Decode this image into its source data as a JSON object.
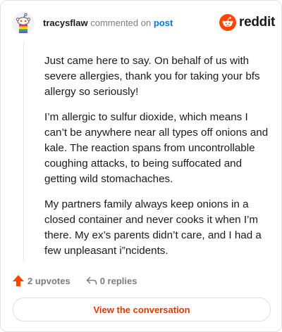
{
  "header": {
    "username": "tracysflaw",
    "commented_on": "commented on",
    "post_link": "post"
  },
  "brand": {
    "wordmark": "reddit",
    "logo_icon": "reddit-alien-icon",
    "color": "#ff4500"
  },
  "comment": {
    "paragraphs": [
      "Just came here to say. On behalf of us with severe allergies, thank you for taking your bfs allergy so seriously!",
      "I’m allergic to sulfur dioxide, which means I can’t be anywhere near all types off onions and kale. The reaction spans from uncontrollable coughing attacks, to being suffocated and getting wild stomachaches.",
      "My partners family always keep onions in a closed container and never cooks it when I’m there. My ex’s parents didn’t care, and I had a few unpleasant i”ncidents."
    ]
  },
  "actions": {
    "upvotes": "2 upvotes",
    "upvote_icon": "upvote-arrow-icon",
    "replies": "0 replies",
    "reply_icon": "reply-arrow-icon"
  },
  "cta": {
    "label": "View the conversation",
    "color": "#d93a00"
  }
}
